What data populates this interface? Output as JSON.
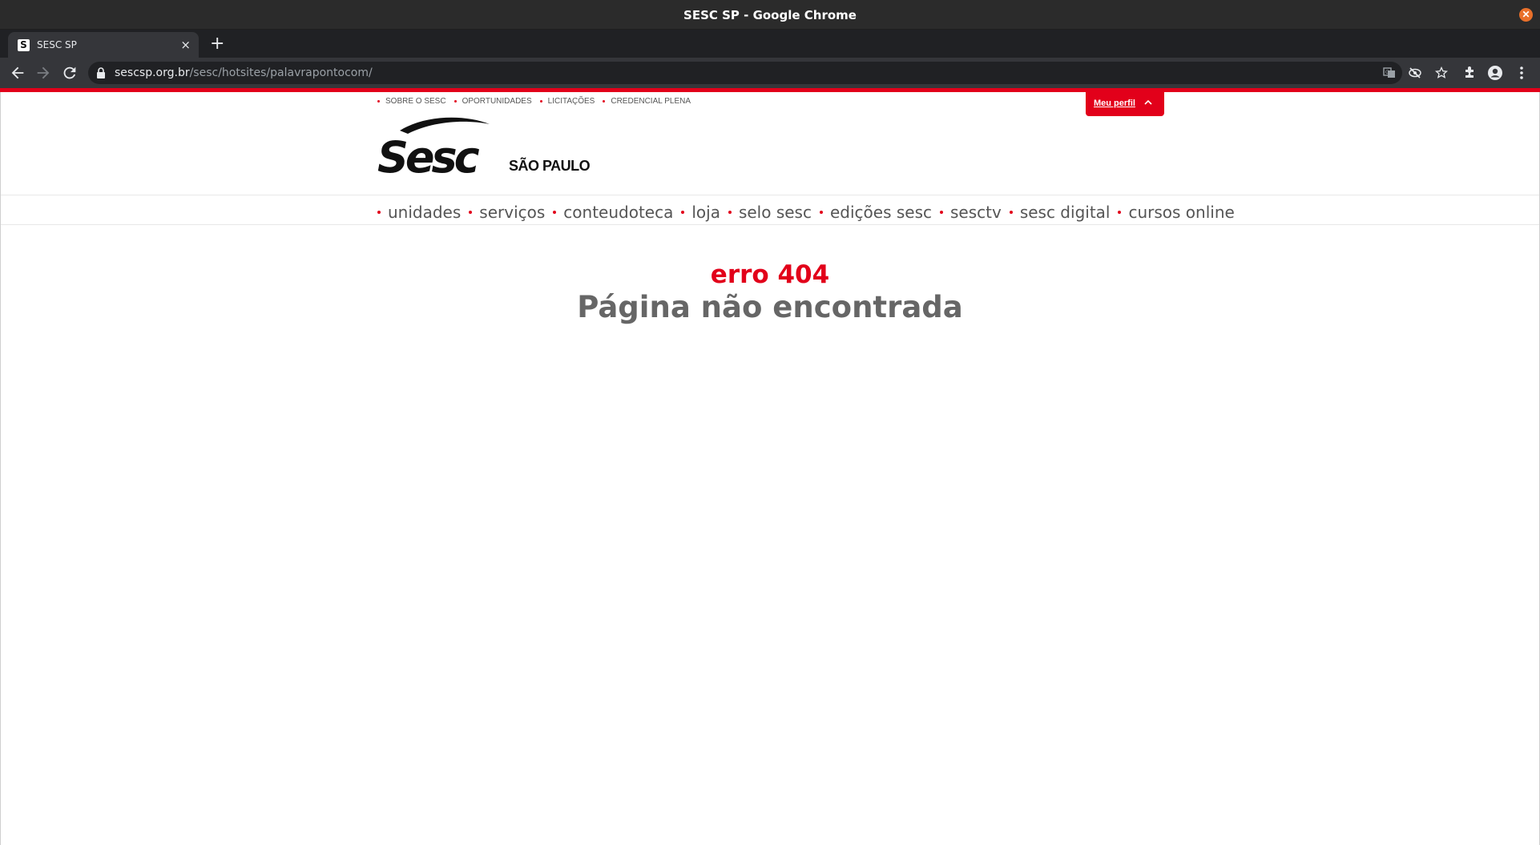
{
  "window": {
    "title": "SESC SP - Google Chrome"
  },
  "tabs": [
    {
      "title": "SESC SP",
      "favicon": "S"
    }
  ],
  "omnibox": {
    "domain": "sescsp.org.br",
    "path": "/sesc/hotsites/palavrapontocom/"
  },
  "icons": {
    "back": "arrow-left-icon",
    "forward": "arrow-right-icon",
    "reload": "reload-icon",
    "translate": "translate-icon",
    "eye_off": "eye-off-icon",
    "star": "star-icon",
    "extensions": "puzzle-icon",
    "profile": "account-icon",
    "menu": "kebab-menu-icon"
  },
  "site": {
    "topnav": [
      {
        "label": "SOBRE O SESC"
      },
      {
        "label": "OPORTUNIDADES"
      },
      {
        "label": "LICITAÇÕES"
      },
      {
        "label": "CREDENCIAL PLENA"
      }
    ],
    "meu_perfil": "Meu perfil",
    "logo_text": "Sesc",
    "logo_subtitle": "SÃO PAULO",
    "mainnav": [
      {
        "label": "unidades"
      },
      {
        "label": "serviços"
      },
      {
        "label": "conteudoteca"
      },
      {
        "label": "loja"
      },
      {
        "label": "selo sesc"
      },
      {
        "label": "edições sesc"
      },
      {
        "label": "sesctv"
      },
      {
        "label": "sesc digital"
      },
      {
        "label": "cursos online"
      }
    ],
    "error_code": "erro 404",
    "error_message": "Página não encontrada"
  },
  "colors": {
    "accent": "#e2001a",
    "chrome_dark": "#202124",
    "text_gray": "#666666"
  }
}
